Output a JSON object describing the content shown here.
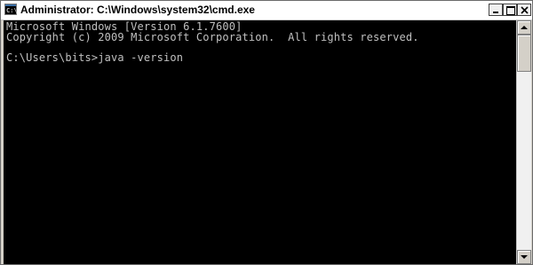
{
  "window": {
    "title": "Administrator: C:\\Windows\\system32\\cmd.exe",
    "icon": "cmd-icon",
    "controls": {
      "minimize_icon": "minimize-icon",
      "maximize_icon": "maximize-icon",
      "close_icon": "close-icon"
    }
  },
  "console": {
    "lines": [
      "Microsoft Windows [Version 6.1.7600]",
      "Copyright (c) 2009 Microsoft Corporation.  All rights reserved.",
      "",
      "C:\\Users\\bits>java -version"
    ],
    "text_color": "#c0c0c0",
    "background_color": "#000000"
  },
  "scrollbar": {
    "up_icon": "arrow-up-icon",
    "down_icon": "arrow-down-icon"
  }
}
